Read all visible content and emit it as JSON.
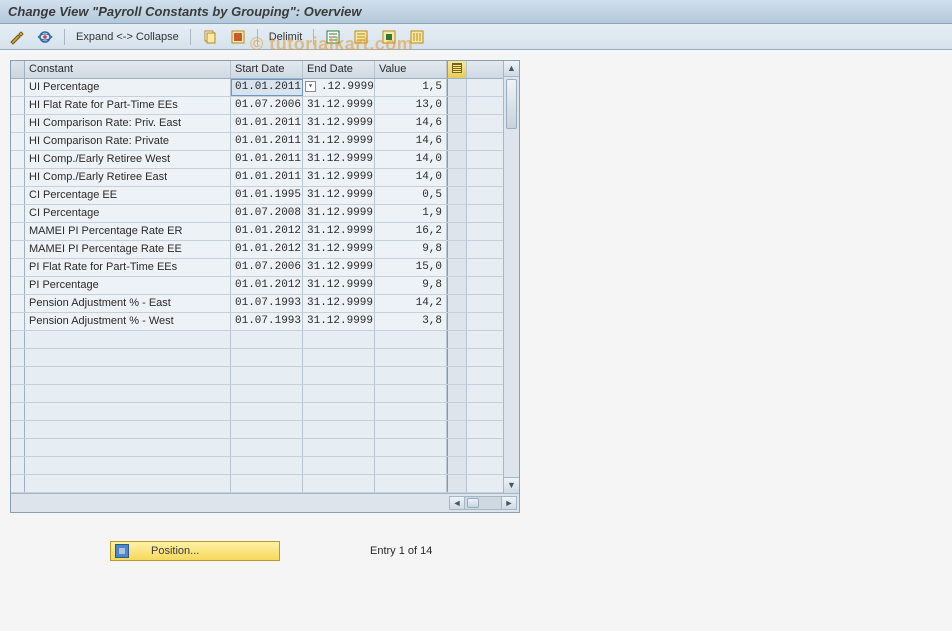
{
  "title": "Change View \"Payroll Constants by Grouping\": Overview",
  "watermark": "© tutorialkart.com",
  "toolbar": {
    "expand_collapse": "Expand <-> Collapse",
    "delimit": "Delimit"
  },
  "grid": {
    "headers": {
      "constant": "Constant",
      "start": "Start Date",
      "end": "End Date",
      "value": "Value"
    },
    "rows": [
      {
        "constant": "UI Percentage",
        "start": "01.01.2011",
        "end": ".12.9999",
        "value": "1,5",
        "end_f4": true,
        "start_selected": true
      },
      {
        "constant": "HI Flat Rate for Part-Time EEs",
        "start": "01.07.2006",
        "end": "31.12.9999",
        "value": "13,0"
      },
      {
        "constant": "HI Comparison Rate: Priv. East",
        "start": "01.01.2011",
        "end": "31.12.9999",
        "value": "14,6"
      },
      {
        "constant": "HI Comparison Rate: Private",
        "start": "01.01.2011",
        "end": "31.12.9999",
        "value": "14,6"
      },
      {
        "constant": "HI Comp./Early Retiree    West",
        "start": "01.01.2011",
        "end": "31.12.9999",
        "value": "14,0"
      },
      {
        "constant": "HI Comp./Early Retiree    East",
        "start": "01.01.2011",
        "end": "31.12.9999",
        "value": "14,0"
      },
      {
        "constant": "CI Percentage EE",
        "start": "01.01.1995",
        "end": "31.12.9999",
        "value": "0,5"
      },
      {
        "constant": "CI Percentage",
        "start": "01.07.2008",
        "end": "31.12.9999",
        "value": "1,9"
      },
      {
        "constant": "MAMEI PI Percentage Rate ER",
        "start": "01.01.2012",
        "end": "31.12.9999",
        "value": "16,2"
      },
      {
        "constant": "MAMEI PI Percentage Rate EE",
        "start": "01.01.2012",
        "end": "31.12.9999",
        "value": "9,8"
      },
      {
        "constant": "PI Flat Rate for Part-Time EEs",
        "start": "01.07.2006",
        "end": "31.12.9999",
        "value": "15,0"
      },
      {
        "constant": "PI Percentage",
        "start": "01.01.2012",
        "end": "31.12.9999",
        "value": "9,8"
      },
      {
        "constant": "Pension Adjustment % - East",
        "start": "01.07.1993",
        "end": "31.12.9999",
        "value": "14,2"
      },
      {
        "constant": "Pension Adjustment % - West",
        "start": "01.07.1993",
        "end": "31.12.9999",
        "value": "3,8"
      }
    ],
    "empty_rows": 9
  },
  "footer": {
    "position_label": "Position...",
    "entry_of": "Entry 1 of 14"
  }
}
